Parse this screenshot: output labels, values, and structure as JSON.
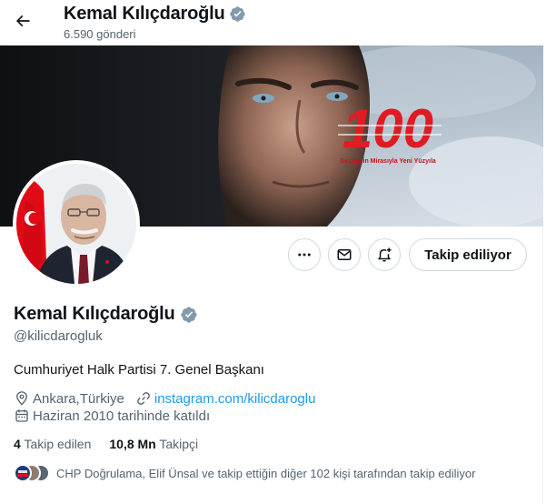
{
  "header": {
    "title": "Kemal Kılıçdaroğlu",
    "post_count": "6.590 gönderi"
  },
  "banner": {
    "headline": "100",
    "tagline": "Geçmişin Mirasıyla Yeni Yüzyıla"
  },
  "profile": {
    "name": "Kemal Kılıçdaroğlu",
    "handle": "@kilicdarogluk",
    "bio": "Cumhuriyet Halk Partisi 7. Genel Başkanı",
    "location": "Ankara,Türkiye",
    "website": "instagram.com/kilicdaroglu",
    "joined": "Haziran 2010 tarihinde katıldı",
    "following_count": "4",
    "following_label": "Takip edilen",
    "followers_count": "10,8 Mn",
    "followers_label": "Takipçi",
    "followers_you_know": "CHP Doğrulama, Elif Ünsal ve takip ettiğin diğer 102 kişi tarafından takip ediliyor"
  },
  "actions": {
    "follow_label": "Takip ediliyor"
  },
  "colors": {
    "accent": "#1d9bf0",
    "text_primary": "#0f1419",
    "text_secondary": "#536471",
    "border": "#cfd9de",
    "verified_badge": "#829aab",
    "banner_red": "#e11b22"
  },
  "icons": {
    "back": "arrow-left-icon",
    "verified": "verified-badge-icon",
    "more": "more-dots-icon",
    "message": "envelope-icon",
    "notify": "bell-plus-icon",
    "location": "location-pin-icon",
    "link": "link-icon",
    "calendar": "calendar-icon"
  }
}
